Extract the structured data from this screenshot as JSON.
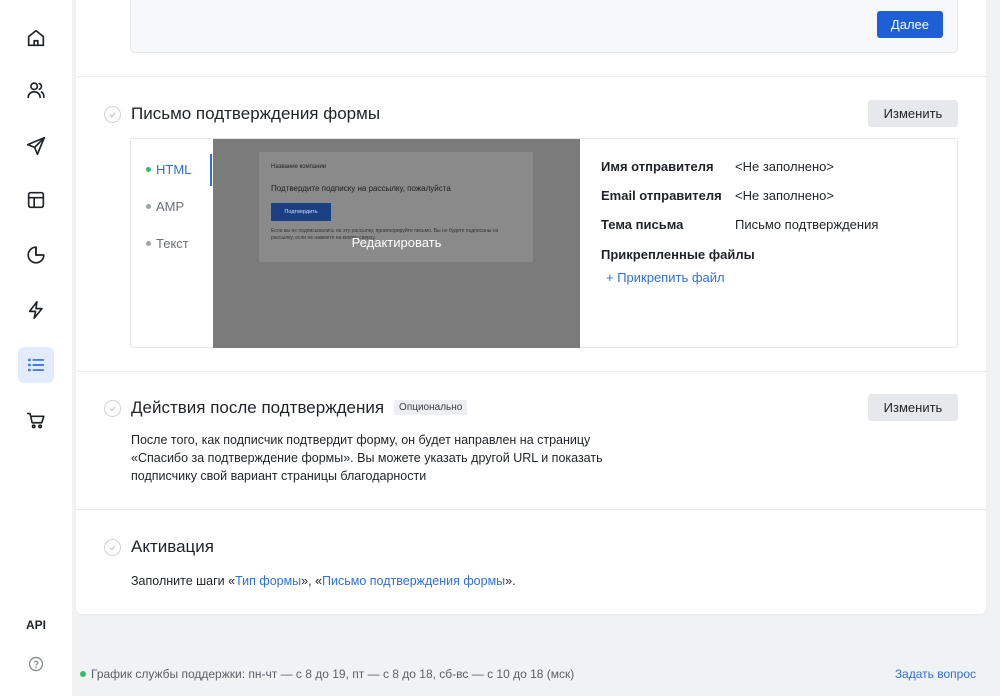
{
  "colors": {
    "accent": "#2f6fe0",
    "primary_button": "#1f5fd6",
    "online_dot": "#2ebf6a",
    "sidebar_active_bg": "#e3ecff"
  },
  "sidebar": {
    "items": [
      {
        "icon": "home-icon"
      },
      {
        "icon": "contacts-icon"
      },
      {
        "icon": "send-icon"
      },
      {
        "icon": "layout-icon"
      },
      {
        "icon": "analytics-icon"
      },
      {
        "icon": "automation-icon"
      },
      {
        "icon": "forms-list-icon",
        "active": true
      },
      {
        "icon": "cart-icon"
      }
    ],
    "api_label": "API",
    "help_icon": "help-circle-icon"
  },
  "top_panel": {
    "next_button": "Далее"
  },
  "confirmation_email": {
    "title": "Письмо подтверждения формы",
    "edit_button": "Изменить",
    "formats": [
      {
        "label": "HTML",
        "active": true
      },
      {
        "label": "AMP",
        "active": false
      },
      {
        "label": "Текст",
        "active": false
      }
    ],
    "preview": {
      "company": "Название компании",
      "heading": "Подтвердите подписку на рассылку, пожалуйста",
      "button": "Подтвердить",
      "note": "Если вы не подписывались на эту рассылку, проигнорируйте письмо. Вы не будете подписаны на рассылку, если не нажмете на кнопку сверху.",
      "overlay": "Редактировать"
    },
    "meta": {
      "sender_name_label": "Имя отправителя",
      "sender_name_value": "<Не заполнено>",
      "sender_email_label": "Email отправителя",
      "sender_email_value": "<Не заполнено>",
      "subject_label": "Тема письма",
      "subject_value": "Письмо подтверждения",
      "attachments_label": "Прикрепленные файлы",
      "attach_link": "+ Прикрепить файл"
    }
  },
  "after_confirmation": {
    "title": "Действия после подтверждения",
    "badge": "Опционально",
    "edit_button": "Изменить",
    "description": "После того, как подписчик подтвердит форму, он будет направлен на страницу «Спасибо за подтверждение формы». Вы можете указать другой URL и показать подписчику свой вариант страницы благодарности"
  },
  "activation": {
    "title": "Активация",
    "text_prefix": "Заполните шаги «",
    "link1": "Тип формы",
    "text_middle": "», «",
    "link2": "Письмо подтверждения формы",
    "text_suffix": "»."
  },
  "footer": {
    "support_schedule": "График службы поддержки: пн-чт — с 8 до 19, пт — с 8 до 18, сб-вс — с 10 до 18 (мск)",
    "ask_question": "Задать вопрос"
  }
}
